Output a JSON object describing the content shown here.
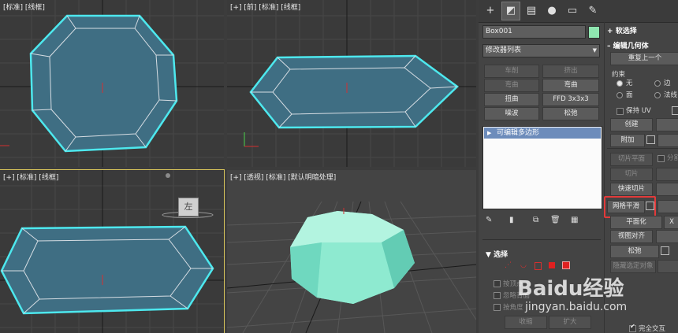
{
  "viewports": {
    "top_left": {
      "label": "[标准] [线框]"
    },
    "top_right": {
      "label": "[+] [前] [标准] [线框]"
    },
    "bottom_left": {
      "label": "[+] [标准] [线框]"
    },
    "bottom_right": {
      "label": "[+] [透视] [标准] [默认明暗处理]"
    },
    "viewcube_face": "左"
  },
  "panel": {
    "tabs": [
      "plus-icon",
      "modify-icon",
      "hierarchy-icon",
      "motion-icon",
      "display-icon",
      "utilities-icon"
    ],
    "object_name": "Box001",
    "object_color": "#8fe6b0",
    "modifier_list": "修改器列表",
    "modifier_buttons": [
      "车削",
      "挤出",
      "弯曲",
      "弯曲",
      "扭曲",
      "FFD 3x3x3",
      "噪波",
      "松弛"
    ],
    "stack_item": "可编辑多边形",
    "soft_selection": "软选择",
    "edit_geometry": "编辑几何体",
    "repeat_last": "重复上一个",
    "constraints": {
      "title": "约束",
      "none": "无",
      "edge": "边",
      "face": "面",
      "normal": "法线"
    },
    "preserve_uv": "保持 UV",
    "create": "创建",
    "attach": "附加",
    "slice_plane": "切片平面",
    "split": "分割",
    "slice": "切片",
    "quickslice": "快速切片",
    "meshsmooth": "网格平滑",
    "planarize": "平面化",
    "x_label": "X",
    "view_align": "视图对齐",
    "relax": "松弛",
    "hide_selected": "隐藏选定对象",
    "selection": {
      "title": "选择",
      "by_vertex": "按顶点",
      "ignore_back": "忽略背面",
      "by_angle": "按角度",
      "shrink": "收缩",
      "grow": "扩大"
    },
    "full_interactive": "完全交互"
  },
  "watermark": {
    "brand": "Baidu经验",
    "url": "jingyan.baidu.com"
  }
}
